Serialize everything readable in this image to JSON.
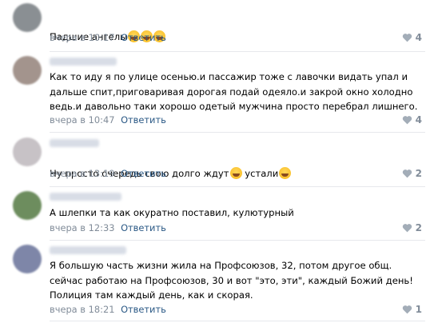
{
  "comments": [
    {
      "text": "Падшие ангелы",
      "emojis": [
        "rolling-laughing-emoji",
        "rolling-laughing-emoji",
        "rolling-laughing-emoji"
      ],
      "time": "вчера в 10:17",
      "reply": "Ответить",
      "likes": "4",
      "avatar_color": "#8a8f93"
    },
    {
      "text": "Как то иду я по улице осенью.и пассажир тоже с лавочки видать упал и дальше спит,приговаривая дорогая подай одеяло.и закрой окно холодно ведь.и давольно таки хорошо одетый мужчина просто перебрал лишнего.",
      "time": "вчера в 10:47",
      "reply": "Ответить",
      "likes": "4",
      "avatar_color": "#a3948d"
    },
    {
      "text": "Ну просто очередь свою долго ждут",
      "text_mid": "устали",
      "emojis": [
        "grinning-sweat-emoji",
        "winking-tongue-emoji"
      ],
      "time": "вчера в 13:19",
      "reply": "Ответить",
      "likes": "2",
      "avatar_color": "#c7c2c6"
    },
    {
      "text": "А шлепки та как окуратно поставил, кулютурный",
      "time": "вчера в 12:33",
      "reply": "Ответить",
      "likes": "2",
      "avatar_color": "#6d8d5e"
    },
    {
      "text": "Я большую часть жизни жила на Профсоюзов, 32, потом другое общ. сейчас работаю на Профсоюзов, 30 и вот \"это, эти\", каждый Божий день! Полиция там каждый день, как и скорая.",
      "time": "вчера в 18:21",
      "reply": "Ответить",
      "likes": "1",
      "avatar_color": "#7e86a8"
    }
  ],
  "colors": {
    "link": "#2a5885",
    "meta": "#818c99",
    "divider": "#e7e8ec"
  }
}
